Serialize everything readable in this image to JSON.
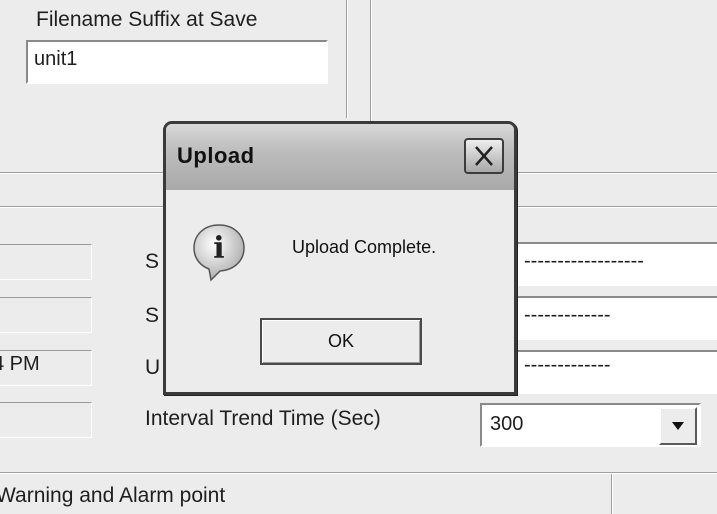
{
  "settings": {
    "filename_suffix_label": "Filename Suffix at Save",
    "filename_suffix_value": "unit1",
    "left_fields": [
      "",
      "",
      "4 PM",
      ""
    ],
    "middle_labels": [
      "S",
      "S",
      "U"
    ],
    "right_fields": [
      "------------------",
      "-------------",
      "-------------"
    ],
    "interval_label": "Interval Trend Time (Sec)",
    "interval_value": "300",
    "section_label": "Warning and Alarm point"
  },
  "dialog": {
    "title": "Upload",
    "message": "Upload Complete.",
    "ok_label": "OK",
    "icon": "info-icon",
    "close_icon": "close-icon"
  }
}
